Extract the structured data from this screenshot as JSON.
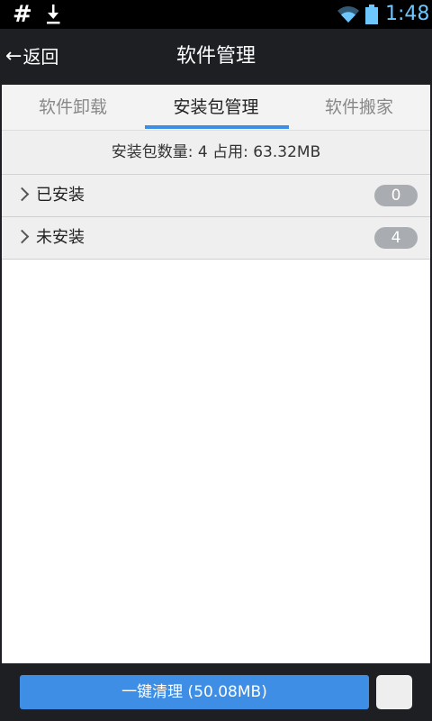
{
  "status_bar": {
    "left_symbol": "#",
    "icons": [
      "download-icon",
      "wifi-icon",
      "battery-icon"
    ],
    "time": "1:48",
    "time_color": "#6ec6ff"
  },
  "header": {
    "back_arrow": "←",
    "back_label": "返回",
    "title": "软件管理"
  },
  "tabs": [
    {
      "label": "软件卸载",
      "active": false
    },
    {
      "label": "安装包管理",
      "active": true
    },
    {
      "label": "软件搬家",
      "active": false
    }
  ],
  "summary": {
    "text": "安装包数量: 4  占用: 63.32MB"
  },
  "groups": [
    {
      "label": "已安装",
      "count": "0"
    },
    {
      "label": "未安装",
      "count": "4"
    }
  ],
  "footer": {
    "clean_label": "一键清理 (50.08MB)",
    "checkbox_checked": false
  },
  "colors": {
    "accent": "#3f8ee6",
    "tab_indicator": "#3d8fe6",
    "dark_bar": "#1d1f22",
    "badge": "#a9adb1"
  }
}
